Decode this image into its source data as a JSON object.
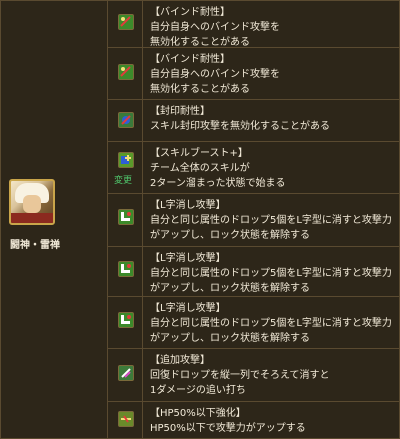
{
  "character": {
    "name": "闘神・雷禅"
  },
  "skills": [
    {
      "icon": "bind-resist-icon",
      "title": "【バインド耐性】",
      "lines": [
        "自分自身へのバインド攻撃を",
        "無効化することがある"
      ]
    },
    {
      "icon": "bind-resist-icon",
      "title": "【バインド耐性】",
      "lines": [
        "自分自身へのバインド攻撃を",
        "無効化することがある"
      ]
    },
    {
      "icon": "skill-seal-resist-icon",
      "title": "【封印耐性】",
      "lines": [
        "スキル封印攻撃を無効化することがある"
      ]
    },
    {
      "icon": "skill-boost-plus-icon",
      "title": "【スキルブースト+】",
      "lines": [
        "チーム全体のスキルが",
        "2ターン溜まった状態で始まる"
      ],
      "badge": "変更"
    },
    {
      "icon": "l-shape-clear-icon",
      "title": "【L字消し攻撃】",
      "lines": [
        "自分と同じ属性のドロップ5個をL字型に消すと攻撃力",
        "がアップし、ロック状態を解除する"
      ]
    },
    {
      "icon": "l-shape-clear-icon",
      "title": "【L字消し攻撃】",
      "lines": [
        "自分と同じ属性のドロップ5個をL字型に消すと攻撃力",
        "がアップし、ロック状態を解除する"
      ]
    },
    {
      "icon": "l-shape-clear-icon",
      "title": "【L字消し攻撃】",
      "lines": [
        "自分と同じ属性のドロップ5個をL字型に消すと攻撃力",
        "がアップし、ロック状態を解除する"
      ]
    },
    {
      "icon": "extra-attack-icon",
      "title": "【追加攻撃】",
      "lines": [
        "回復ドロップを縦一列でそろえて消すと",
        "1ダメージの追い打ち"
      ]
    },
    {
      "icon": "hp50-below-boost-icon",
      "title": "【HP50%以下強化】",
      "lines": [
        "HP50%以下で攻撃力がアップする"
      ]
    }
  ]
}
